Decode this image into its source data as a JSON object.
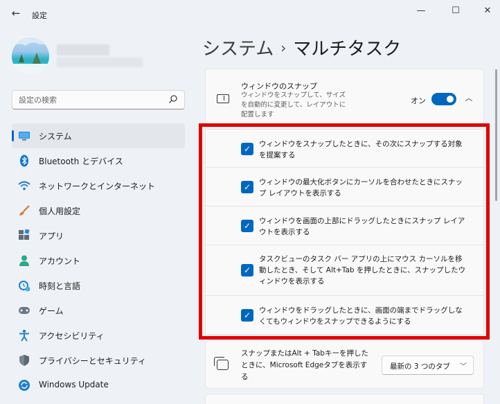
{
  "window": {
    "title": "設定",
    "back_icon": "←",
    "minimize_icon": "—",
    "maximize_icon": "☐",
    "close_icon": "✕"
  },
  "search": {
    "placeholder": "設定の検索"
  },
  "sidebar": {
    "items": [
      {
        "label": "システム",
        "icon": "system-icon",
        "active": true
      },
      {
        "label": "Bluetooth とデバイス",
        "icon": "bluetooth-icon"
      },
      {
        "label": "ネットワークとインターネット",
        "icon": "wifi-icon"
      },
      {
        "label": "個人用設定",
        "icon": "brush-icon"
      },
      {
        "label": "アプリ",
        "icon": "apps-icon"
      },
      {
        "label": "アカウント",
        "icon": "account-icon"
      },
      {
        "label": "時刻と言語",
        "icon": "time-language-icon"
      },
      {
        "label": "ゲーム",
        "icon": "gamepad-icon"
      },
      {
        "label": "アクセシビリティ",
        "icon": "accessibility-icon"
      },
      {
        "label": "プライバシーとセキュリティ",
        "icon": "shield-icon"
      },
      {
        "label": "Windows Update",
        "icon": "update-icon"
      }
    ]
  },
  "header": {
    "breadcrumb_parent": "システム",
    "separator": "›",
    "title": "マルチタスク"
  },
  "snap": {
    "title": "ウィンドウのスナップ",
    "description": "ウィンドウをスナップして、サイズを自動的に変更して、レイアウトに配置します",
    "toggle_label": "オン",
    "toggle_on": true,
    "expand_icon": "︿",
    "options": [
      {
        "checked": true,
        "text": "ウィンドウをスナップしたときに、その次にスナップする対象を提案する"
      },
      {
        "checked": true,
        "text": "ウィンドウの最大化ボタンにカーソルを合わせたときにスナップ レイアウトを表示する"
      },
      {
        "checked": true,
        "text": "ウィンドウを画面の上部にドラッグしたときにスナップ レイアウトを表示する"
      },
      {
        "checked": true,
        "text": "タスクビューのタスク バー アプリの上にマウス カーソルを移動したとき、そして Alt+Tab を押したときに、スナップしたウィンドウを表示する"
      },
      {
        "checked": true,
        "text": "ウィンドウをドラッグしたときに、画面の端までドラッグしなくてもウィンドウをスナップできるようにする"
      }
    ]
  },
  "alt_tab": {
    "text": "スナップまたはAlt + Tabキーを押したときに、Microsoft Edgeタブを表示する",
    "dropdown_value": "最新の 3 つのタブ",
    "dropdown_icon": "﹀"
  },
  "colors": {
    "accent": "#0067c0",
    "highlight": "#e00000"
  }
}
